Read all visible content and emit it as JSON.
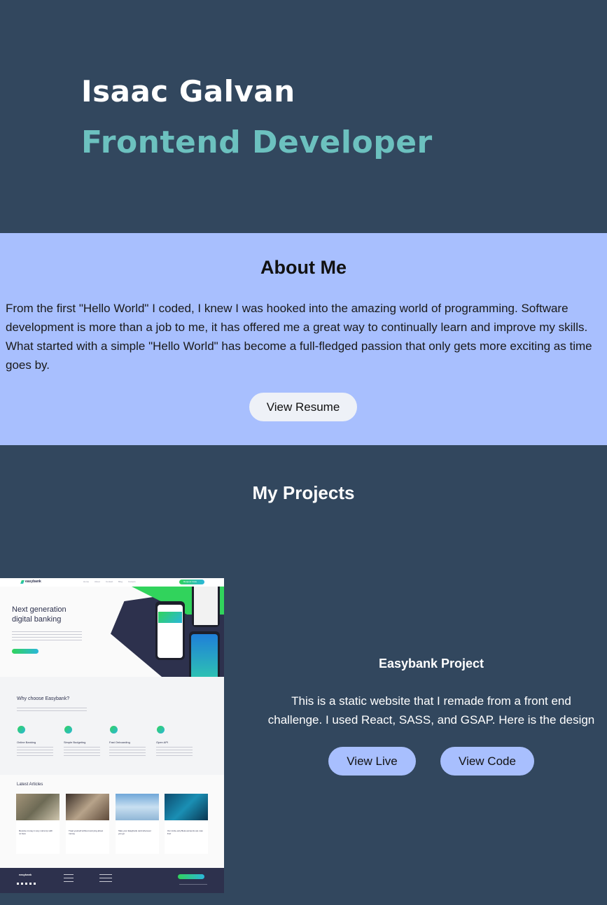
{
  "hero": {
    "name": "Isaac Galvan",
    "role": "Frontend Developer"
  },
  "about": {
    "title": "About Me",
    "text": "From the first \"Hello World\" I coded, I knew I was hooked into the amazing world of programming. Software development is more than a job to me, it has offered me a great way to continually learn and improve my skills. What started with a simple \"Hello World\" has become a full-fledged passion that only gets more exciting as time goes by.",
    "resume_label": "View Resume"
  },
  "projects": {
    "title": "My Projects",
    "items": [
      {
        "title": "Easybank Project",
        "description": "This is a static website that I remade from a front end challenge. I used React, SASS, and GSAP. Here is the design",
        "live_label": "View Live",
        "code_label": "View Code",
        "screenshot": {
          "logo": "easybank",
          "nav": [
            "Home",
            "About",
            "Contact",
            "Blog",
            "Careers"
          ],
          "cta": "Request Invite",
          "headline": "Next generation digital banking",
          "why_title": "Why choose Easybank?",
          "features": [
            "Online Banking",
            "Simple Budgeting",
            "Fast Onboarding",
            "Open API"
          ],
          "articles_title": "Latest Articles",
          "articles": [
            "Receive money in any currency with no fees",
            "Treat yourself without worrying about money",
            "Take your Easybank card wherever you go",
            "Our invite-only Beta accounts are now live!"
          ]
        }
      }
    ]
  },
  "colors": {
    "background": "#32475e",
    "accent_teal": "#6cc1bf",
    "about_bg": "#a8bffe",
    "button_light": "#eef1f7",
    "easybank_green": "#31d35c",
    "easybank_cyan": "#2bb7da",
    "easybank_navy": "#2d314d"
  }
}
